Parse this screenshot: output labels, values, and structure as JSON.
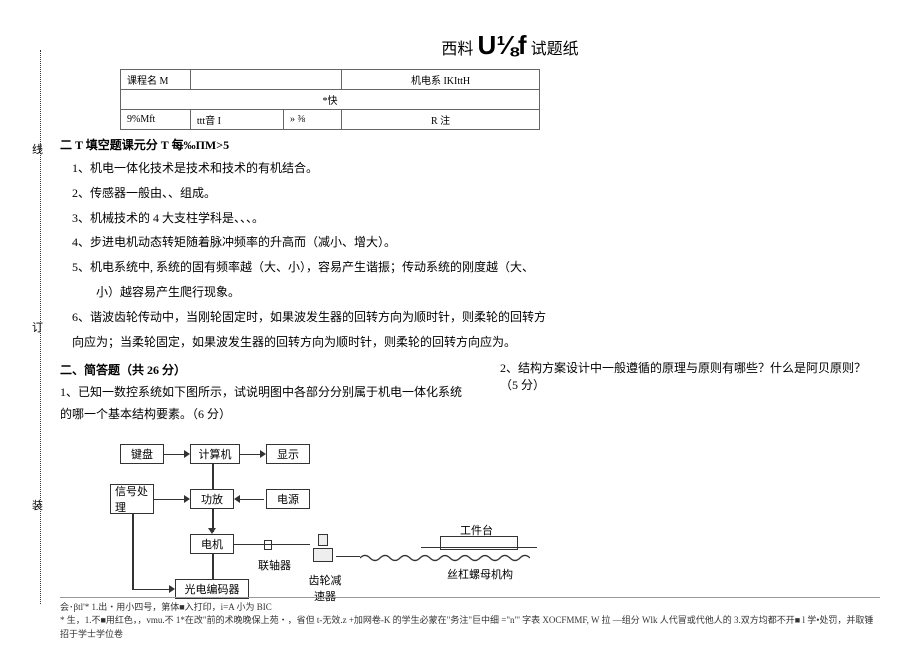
{
  "title_prefix": "西料",
  "title_big": "U⅛f",
  "title_suffix": "试题纸",
  "margin_labels": [
    "线",
    "订",
    "装"
  ],
  "table": {
    "row1_left": "课程名 M",
    "row1_right": "机电系 IKIttH",
    "row2_left": "*快",
    "row3_left": "9%Mft",
    "row3_mid": "ttt音 I",
    "row3_mid2": "» ⅜",
    "row3_right": "R 注"
  },
  "section1_title": "二 T 填空题课元分 T 每‰ΠM>5",
  "fill_blanks": [
    "1、机电一体化技术是技术和技术的有机结合。",
    "2、传感器一般由、、组成。",
    "3、机械技术的 4 大支柱学科是、、、。",
    "4、步进电机动态转矩随着脉冲频率的升高而（减小、增大）。",
    "5、机电系统中, 系统的固有频率越（大、小），容易产生谐振；传动系统的刚度越（大、",
    "小）越容易产生爬行现象。",
    "6、谐波齿轮传动中，当刚轮固定时，如果波发生器的回转方向为顺时针，则柔轮的回转方",
    "向应为；当柔轮固定，如果波发生器的回转方向为顺时针，则柔轮的回转方向应为。"
  ],
  "section2_title": "二、简答题（共 26 分）",
  "q1": "1、已知一数控系统如下图所示，试说明图中各部分分别属于机电一体化系统的哪一个基本结构要素。（6 分）",
  "q2": "2、结构方案设计中一般遵循的原理与原则有哪些？什么是阿贝原则？（5 分）",
  "diagram": {
    "keyboard": "键盘",
    "computer": "计算机",
    "display": "显示",
    "signal": "信号处理",
    "power_amp": "功放",
    "power": "电源",
    "motor": "电机",
    "coupling": "联轴器",
    "encoder": "光电编码器",
    "gear": "齿轮减速器",
    "worktable": "工件台",
    "screw_mech": "丝杠螺母机构"
  },
  "footnote_line1": "会･βtl'* 1.出・用小四号，第体■入打印，i=A 小为 BIC",
  "footnote_line2": "* 生，1.不■用红色，，vmu.不 1*在改\"前的术晚晚保上苑・，省但 t-无效.z +加网卷-K 的学生必蒙在\"务注\"巨中细 =\"n\"' 字表 XOCFMMF, W 拉 ―组分 Wlk 人代冒或代他人的 3.双方均都不开■ l 学•处罚，并取锤招于学士学位卷"
}
